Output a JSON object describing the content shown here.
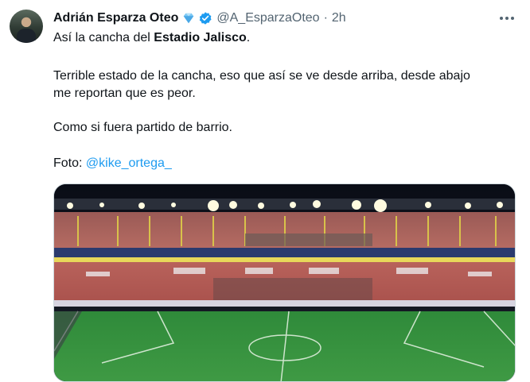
{
  "tweet": {
    "author_name": "Adrián Esparza Oteo",
    "handle": "@A_EsparzaOteo",
    "separator": "·",
    "time": "2h",
    "line1_prefix": "Así la cancha del ",
    "line1_bold": "Estadio Jalisco",
    "line1_suffix": ".",
    "para2_line1": "Terrible estado de la cancha, eso que así se ve desde arriba, desde abajo",
    "para2_line2": "me reportan que es peor.",
    "para3": "Como si fuera partido de barrio.",
    "photo_label": "Foto: ",
    "photo_mention": "@kike_ortega_"
  },
  "colors": {
    "text": "#0f1419",
    "secondary": "#536471",
    "link": "#1d9bf0",
    "verified": "#1d9bf0"
  },
  "icons": {
    "diamond": "blue-diamond-icon",
    "verified": "verified-badge-icon",
    "more": "more-options-icon"
  }
}
